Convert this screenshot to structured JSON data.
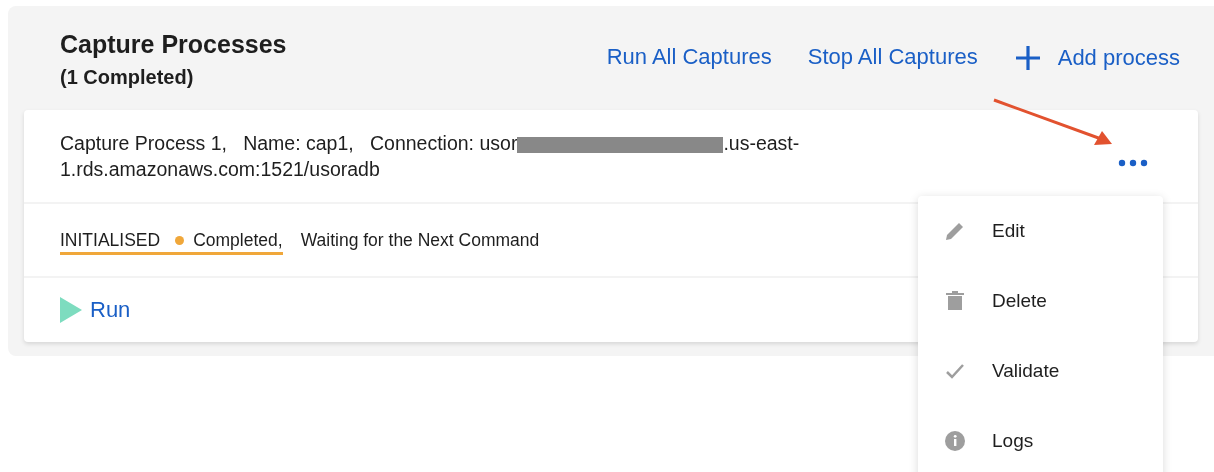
{
  "header": {
    "title": "Capture Processes",
    "subtitle": "(1 Completed)",
    "actions": [
      {
        "kind": "link",
        "label": "Run All Captures"
      },
      {
        "kind": "link",
        "label": "Stop All Captures"
      },
      {
        "kind": "add",
        "label": "Add process"
      }
    ]
  },
  "process": {
    "description_lines": [
      [
        {
          "kind": "text",
          "text": "Capture Process 1,   Name: cap1,   Connection: usor"
        },
        {
          "kind": "redacted"
        },
        {
          "kind": "text",
          "text": ".us-east-"
        }
      ],
      [
        {
          "kind": "text",
          "text": "1.rds.amazonaws.com:1521/usoradb"
        }
      ]
    ],
    "status": {
      "state": "INITIALISED",
      "result": "Completed,",
      "color": "#f0a73a",
      "message": "Waiting for the Next Command"
    },
    "run_label": "Run"
  },
  "menu": {
    "items": [
      {
        "kind": "edit",
        "label": "Edit"
      },
      {
        "kind": "delete",
        "label": "Delete"
      },
      {
        "kind": "validate",
        "label": "Validate"
      },
      {
        "kind": "logs",
        "label": "Logs"
      }
    ]
  }
}
